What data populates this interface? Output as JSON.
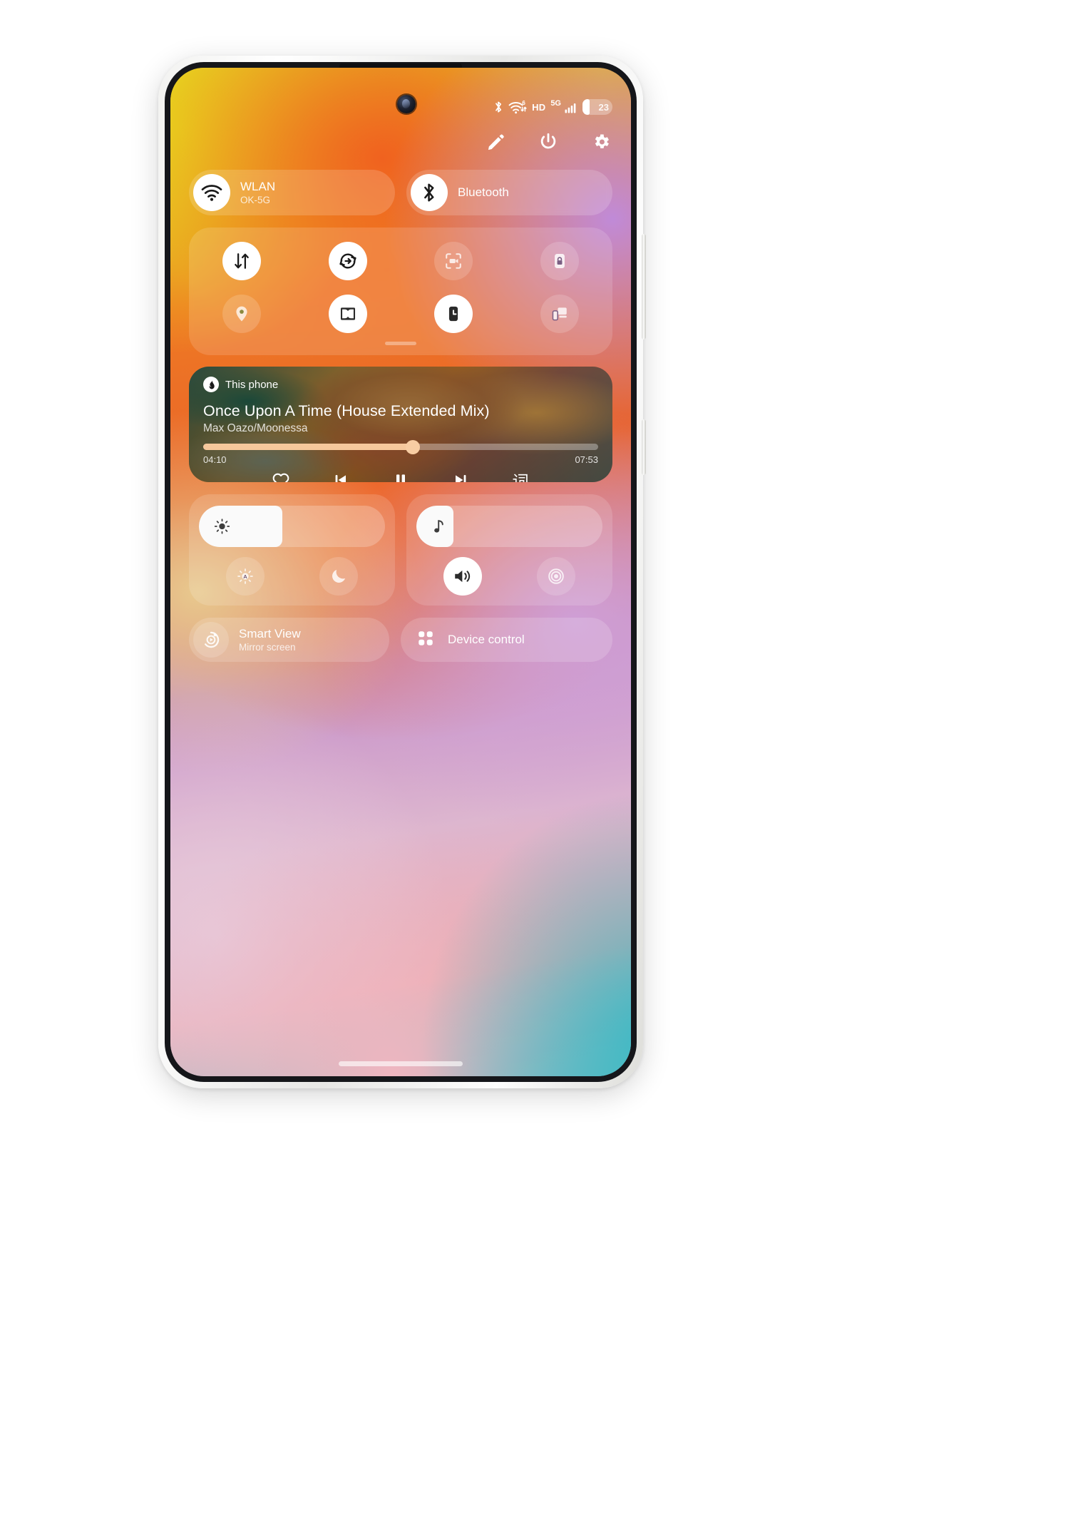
{
  "statusbar": {
    "bluetooth_icon": "bluetooth-icon",
    "wifi_icon": "wifi-6-data-icon",
    "wifi_generation": "6",
    "hd_label": "HD",
    "network_label": "5G",
    "signal_icon": "signal-bars-icon",
    "battery_percent": "23"
  },
  "header": {
    "edit_label": "edit-pencil",
    "power_label": "power",
    "settings_label": "settings"
  },
  "quick_tiles": [
    {
      "name": "wlan",
      "title": "WLAN",
      "subtitle": "OK-5G",
      "icon": "wifi-icon",
      "active": true
    },
    {
      "name": "bluetooth",
      "title": "Bluetooth",
      "subtitle": "",
      "icon": "bluetooth-icon",
      "active": true
    }
  ],
  "toggles": [
    {
      "name": "mobile-data",
      "icon": "data-transfer-icon",
      "active": true
    },
    {
      "name": "auto-rotate",
      "icon": "auto-rotate-icon",
      "active": true
    },
    {
      "name": "screen-recorder",
      "icon": "screen-recorder-icon",
      "active": false
    },
    {
      "name": "screen-lock",
      "icon": "lock-icon",
      "active": false
    },
    {
      "name": "location",
      "icon": "location-pin-icon",
      "active": false
    },
    {
      "name": "dolby-atmos",
      "icon": "dolby-icon",
      "active": true
    },
    {
      "name": "screen-time",
      "icon": "clock-icon",
      "active": true
    },
    {
      "name": "screen-cast",
      "icon": "multi-screen-icon",
      "active": false
    }
  ],
  "media": {
    "source_label": "This phone",
    "source_icon": "music-app-icon",
    "title": "Once Upon A Time (House Extended Mix)",
    "artist": "Max Oazo/Moonessa",
    "elapsed": "04:10",
    "duration": "07:53",
    "progress_percent": 53,
    "controls": [
      {
        "name": "favorite-button",
        "icon": "heart-icon"
      },
      {
        "name": "previous-button",
        "icon": "previous-track-icon"
      },
      {
        "name": "pause-button",
        "icon": "pause-icon"
      },
      {
        "name": "next-button",
        "icon": "next-track-icon"
      },
      {
        "name": "lyrics-button",
        "icon": "lyrics-icon",
        "glyph": "词"
      }
    ]
  },
  "sliders": {
    "brightness": {
      "name": "brightness-slider",
      "icon": "brightness-icon",
      "value_percent": 45,
      "buttons": [
        {
          "name": "auto-brightness",
          "icon": "auto-brightness-icon",
          "active": false
        },
        {
          "name": "dark-mode",
          "icon": "moon-icon",
          "active": false
        }
      ]
    },
    "volume": {
      "name": "volume-slider",
      "icon": "music-note-icon",
      "value_percent": 20,
      "buttons": [
        {
          "name": "sound-mode",
          "icon": "speaker-icon",
          "active": true
        },
        {
          "name": "vibration-mode",
          "icon": "vibration-icon",
          "active": false
        }
      ]
    }
  },
  "bottom_tiles": [
    {
      "name": "smart-view",
      "title": "Smart View",
      "subtitle": "Mirror screen",
      "icon": "smart-view-icon"
    },
    {
      "name": "device-control",
      "title": "Device control",
      "subtitle": "",
      "icon": "grid-dots-icon"
    }
  ]
}
